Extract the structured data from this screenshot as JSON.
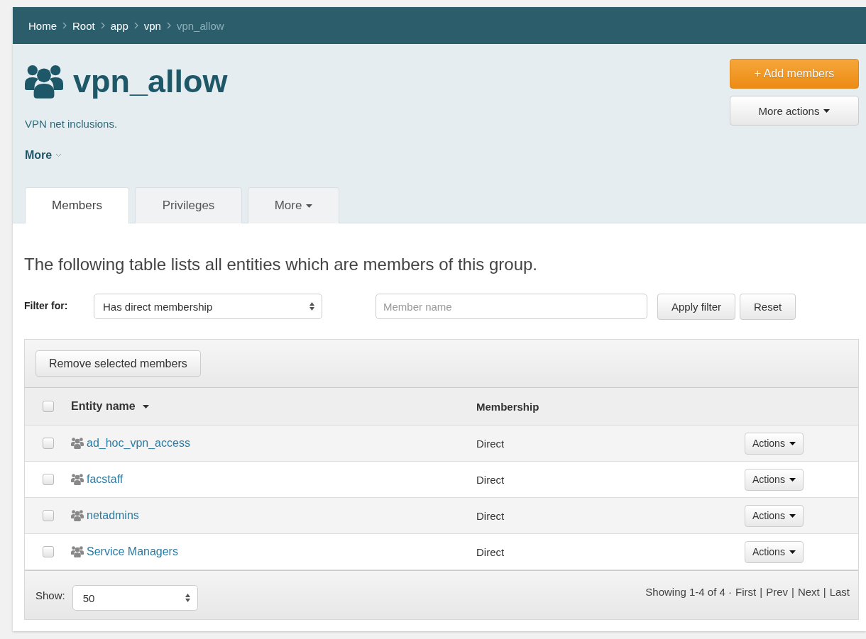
{
  "breadcrumbs": [
    {
      "label": "Home",
      "current": false
    },
    {
      "label": "Root",
      "current": false
    },
    {
      "label": "app",
      "current": false
    },
    {
      "label": "vpn",
      "current": false
    },
    {
      "label": "vpn_allow",
      "current": true
    }
  ],
  "group": {
    "title": "vpn_allow",
    "description": "VPN net inclusions.",
    "more_toggle": "More"
  },
  "header_buttons": [
    {
      "label": "+ Add members",
      "kind": "primary"
    },
    {
      "label": "More actions",
      "kind": "dropdown"
    }
  ],
  "tabs": [
    {
      "label": "Members",
      "selected": true,
      "dropdown": false
    },
    {
      "label": "Privileges",
      "selected": false,
      "dropdown": false
    },
    {
      "label": "More",
      "selected": false,
      "dropdown": true
    }
  ],
  "intro": "The following table lists all entities which are members of this group.",
  "filter": {
    "label": "Filter for:",
    "select_value": "Has direct membership",
    "name_placeholder": "Member name",
    "buttons": [
      "Apply filter",
      "Reset"
    ]
  },
  "toolbar_button": "Remove selected members",
  "table": {
    "select_all_checked": false,
    "columns": [
      {
        "label": "Entity name",
        "sorted": true
      },
      {
        "label": "Membership",
        "sorted": false
      }
    ],
    "rows": [
      {
        "name": "ad_hoc_vpn_access",
        "membership": "Direct",
        "action": "Actions",
        "checked": false
      },
      {
        "name": "facstaff",
        "membership": "Direct",
        "action": "Actions",
        "checked": false
      },
      {
        "name": "netadmins",
        "membership": "Direct",
        "action": "Actions",
        "checked": false
      },
      {
        "name": "Service Managers",
        "membership": "Direct",
        "action": "Actions",
        "checked": false
      }
    ]
  },
  "footer": {
    "show_label": "Show:",
    "page_size": "50",
    "summary": "Showing 1-4 of 4 ·",
    "separator": "|",
    "links": [
      "First",
      "Prev",
      "Next",
      "Last"
    ]
  }
}
